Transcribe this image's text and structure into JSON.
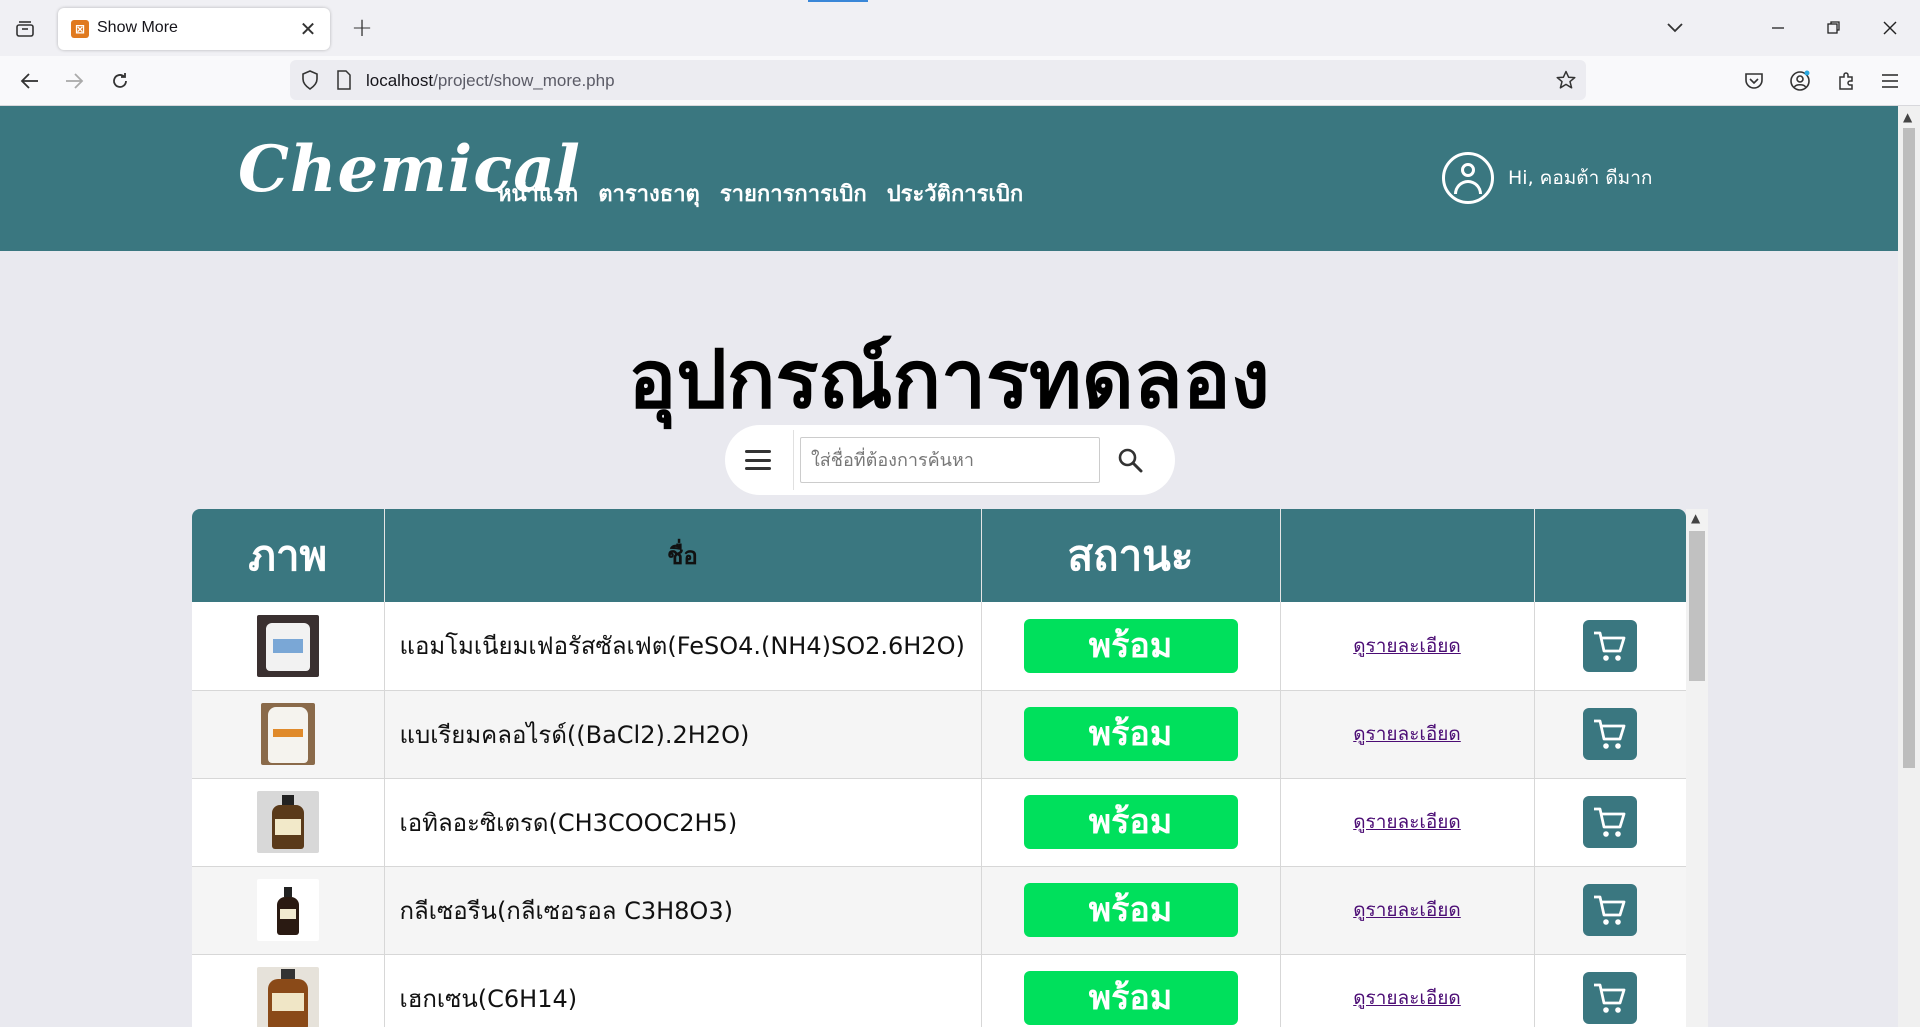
{
  "browser": {
    "tab_title": "Show More",
    "url_host": "localhost",
    "url_path": "/project/show_more.php",
    "tab_close_glyph": "✕",
    "new_tab_glyph": "+"
  },
  "header": {
    "logo": "Chemical",
    "menu": [
      {
        "label": "หน้าแรก"
      },
      {
        "label": "ตารางธาตุ"
      },
      {
        "label": "รายการการเบิก"
      },
      {
        "label": "ประวัติการเบิก"
      }
    ],
    "greeting": "Hi, คอมต้า ดีมาก"
  },
  "main": {
    "title": "อุปกรณ์การทดลอง",
    "search_placeholder": "ใส่ชื่อที่ต้องการค้นหา"
  },
  "table": {
    "headers": [
      "ภาพ",
      "ชื่อ",
      "สถานะ",
      "",
      ""
    ],
    "rows": [
      {
        "name": "แอมโมเนียมเฟอรัสซัลเฟต(FeSO4.(NH4)SO2.6H2O)",
        "status": "พร้อม",
        "detail": "ดูรายละเอียด"
      },
      {
        "name": "แบเรียมคลอไรด์((BaCl2).2H2O)",
        "status": "พร้อม",
        "detail": "ดูรายละเอียด"
      },
      {
        "name": "เอทิลอะซิเตรด(CH3COOC2H5)",
        "status": "พร้อม",
        "detail": "ดูรายละเอียด"
      },
      {
        "name": "กลีเซอรีน(กลีเซอรอล C3H8O3)",
        "status": "พร้อม",
        "detail": "ดูรายละเอียด"
      },
      {
        "name": "เฮกเซน(C6H14)",
        "status": "พร้อม",
        "detail": "ดูรายละเอียด"
      }
    ]
  },
  "colors": {
    "header_bg": "#3a7780",
    "status_ready": "#00e05c",
    "link": "#4b0c74"
  }
}
